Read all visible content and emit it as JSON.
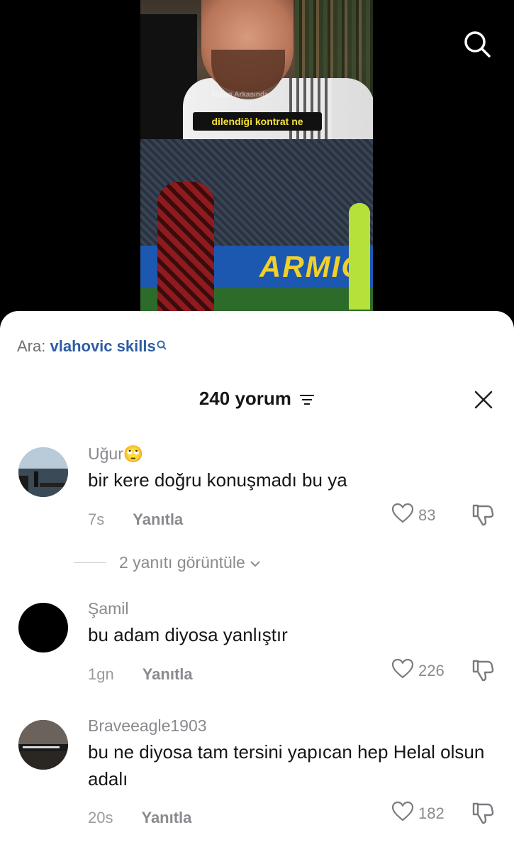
{
  "video": {
    "caption": "dilendiği kontrat ne",
    "watermark": "Topun Arkasında",
    "banner_text": "ARMIO"
  },
  "sheet": {
    "search_prefix": "Ara:",
    "search_term": "vlahovic skills",
    "comment_count_label": "240 yorum"
  },
  "comments": [
    {
      "username": "Uğur🙄",
      "text": "bir kere doğru konuşmadı bu ya",
      "time": "7s",
      "reply_label": "Yanıtla",
      "likes": "83",
      "view_replies": "2 yanıtı görüntüle"
    },
    {
      "username": "Şamil",
      "text": "bu adam diyosa yanlıştır",
      "time": "1gn",
      "reply_label": "Yanıtla",
      "likes": "226"
    },
    {
      "username": "Braveeagle1903",
      "text": "bu ne diyosa tam tersini yapıcan hep Helal olsun adalı",
      "time": "20s",
      "reply_label": "Yanıtla",
      "likes": "182"
    }
  ],
  "icons": {
    "top": "search-icon",
    "filter": "sort-icon",
    "close": "close-icon",
    "like": "heart-icon",
    "dislike": "thumbs-down-icon"
  }
}
